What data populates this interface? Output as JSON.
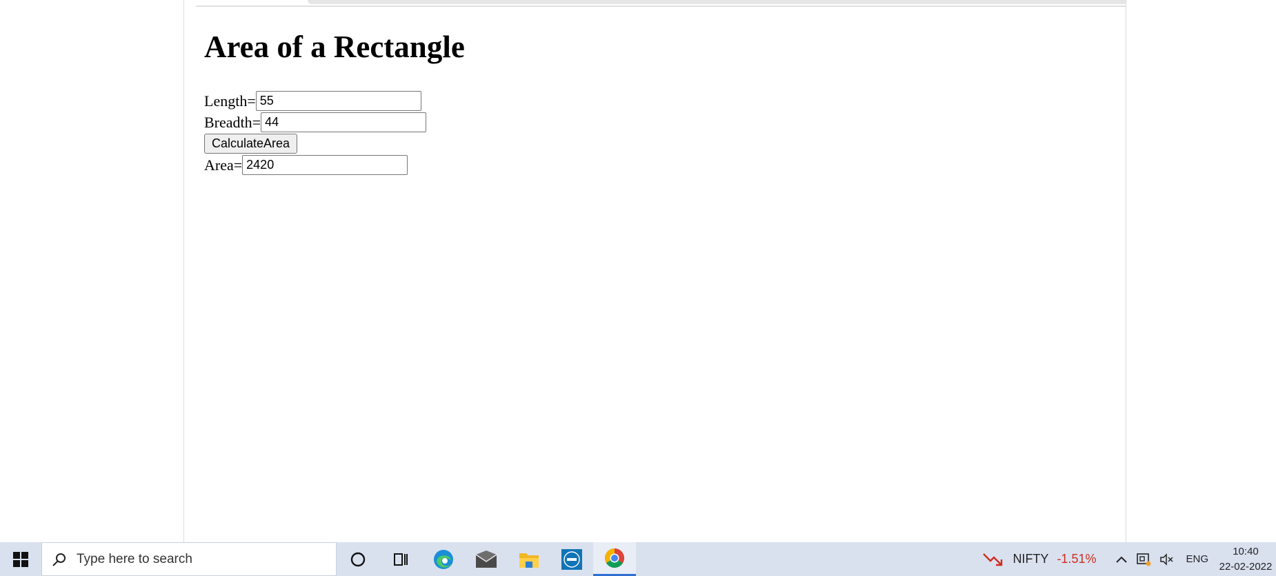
{
  "page": {
    "title": "Area of a Rectangle",
    "length_label": "Length=",
    "length_value": "55",
    "breadth_label": "Breadth=",
    "breadth_value": "44",
    "button_label": "CalculateArea",
    "area_label": "Area=",
    "area_value": "2420"
  },
  "taskbar": {
    "search_placeholder": "Type here to search",
    "apps": [
      "cortana-icon",
      "task-view-icon",
      "edge-icon",
      "mail-icon",
      "file-explorer-icon",
      "dell-icon",
      "chrome-icon"
    ],
    "nifty_label": "NIFTY",
    "nifty_change": "-1.51%",
    "language": "ENG",
    "time": "10:40",
    "date": "22-02-2022"
  },
  "colors": {
    "taskbar_bg": "#d9e1ef",
    "nifty_negative": "#d12b1e",
    "chrome_active_underline": "#2f6fd1"
  }
}
